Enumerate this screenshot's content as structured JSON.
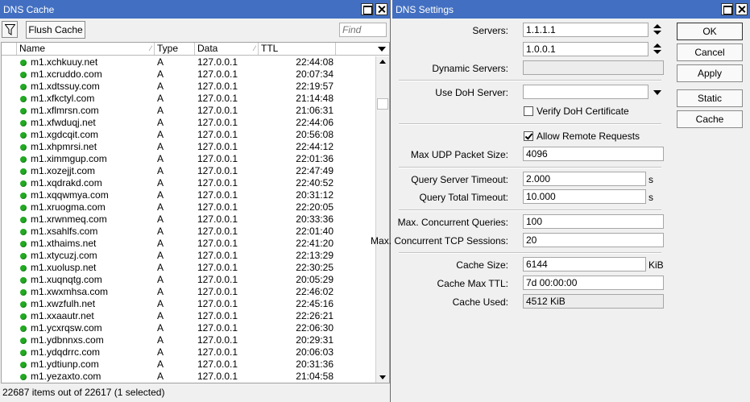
{
  "cache_window": {
    "title": "DNS Cache",
    "flush_label": "Flush Cache",
    "find_placeholder": "Find",
    "columns": {
      "name": "Name",
      "type": "Type",
      "data": "Data",
      "ttl": "TTL"
    },
    "rows": [
      {
        "name": "m1.xchkuuy.net",
        "type": "A",
        "data": "127.0.0.1",
        "ttl": "22:44:08"
      },
      {
        "name": "m1.xcruddo.com",
        "type": "A",
        "data": "127.0.0.1",
        "ttl": "20:07:34"
      },
      {
        "name": "m1.xdtssuy.com",
        "type": "A",
        "data": "127.0.0.1",
        "ttl": "22:19:57"
      },
      {
        "name": "m1.xfkctyl.com",
        "type": "A",
        "data": "127.0.0.1",
        "ttl": "21:14:48"
      },
      {
        "name": "m1.xflmrsn.com",
        "type": "A",
        "data": "127.0.0.1",
        "ttl": "21:06:31"
      },
      {
        "name": "m1.xfwduqj.net",
        "type": "A",
        "data": "127.0.0.1",
        "ttl": "22:44:06"
      },
      {
        "name": "m1.xgdcqit.com",
        "type": "A",
        "data": "127.0.0.1",
        "ttl": "20:56:08"
      },
      {
        "name": "m1.xhpmrsi.net",
        "type": "A",
        "data": "127.0.0.1",
        "ttl": "22:44:12"
      },
      {
        "name": "m1.ximmgup.com",
        "type": "A",
        "data": "127.0.0.1",
        "ttl": "22:01:36"
      },
      {
        "name": "m1.xozejjt.com",
        "type": "A",
        "data": "127.0.0.1",
        "ttl": "22:47:49"
      },
      {
        "name": "m1.xqdrakd.com",
        "type": "A",
        "data": "127.0.0.1",
        "ttl": "22:40:52"
      },
      {
        "name": "m1.xqqwmya.com",
        "type": "A",
        "data": "127.0.0.1",
        "ttl": "20:31:12"
      },
      {
        "name": "m1.xruogma.com",
        "type": "A",
        "data": "127.0.0.1",
        "ttl": "22:20:05"
      },
      {
        "name": "m1.xrwnmeq.com",
        "type": "A",
        "data": "127.0.0.1",
        "ttl": "20:33:36"
      },
      {
        "name": "m1.xsahlfs.com",
        "type": "A",
        "data": "127.0.0.1",
        "ttl": "22:01:40"
      },
      {
        "name": "m1.xthaims.net",
        "type": "A",
        "data": "127.0.0.1",
        "ttl": "22:41:20"
      },
      {
        "name": "m1.xtycuzj.com",
        "type": "A",
        "data": "127.0.0.1",
        "ttl": "22:13:29"
      },
      {
        "name": "m1.xuolusp.net",
        "type": "A",
        "data": "127.0.0.1",
        "ttl": "22:30:25"
      },
      {
        "name": "m1.xuqnqtg.com",
        "type": "A",
        "data": "127.0.0.1",
        "ttl": "20:05:29"
      },
      {
        "name": "m1.xwxmhsa.com",
        "type": "A",
        "data": "127.0.0.1",
        "ttl": "22:46:02"
      },
      {
        "name": "m1.xwzfulh.net",
        "type": "A",
        "data": "127.0.0.1",
        "ttl": "22:45:16"
      },
      {
        "name": "m1.xxaautr.net",
        "type": "A",
        "data": "127.0.0.1",
        "ttl": "22:26:21"
      },
      {
        "name": "m1.ycxrqsw.com",
        "type": "A",
        "data": "127.0.0.1",
        "ttl": "22:06:30"
      },
      {
        "name": "m1.ydbnnxs.com",
        "type": "A",
        "data": "127.0.0.1",
        "ttl": "20:29:31"
      },
      {
        "name": "m1.ydqdrrc.com",
        "type": "A",
        "data": "127.0.0.1",
        "ttl": "20:06:03"
      },
      {
        "name": "m1.ydtiunp.com",
        "type": "A",
        "data": "127.0.0.1",
        "ttl": "20:31:36"
      },
      {
        "name": "m1.yezaxto.com",
        "type": "A",
        "data": "127.0.0.1",
        "ttl": "21:04:58"
      }
    ],
    "status": "22687 items out of 22617 (1 selected)"
  },
  "settings_window": {
    "title": "DNS Settings",
    "labels": {
      "servers": "Servers:",
      "dynamic_servers": "Dynamic Servers:",
      "use_doh": "Use DoH Server:",
      "verify_doh": "Verify DoH Certificate",
      "allow_remote": "Allow Remote Requests",
      "max_udp": "Max UDP Packet Size:",
      "query_server_timeout": "Query Server Timeout:",
      "query_total_timeout": "Query Total Timeout:",
      "max_conc_queries": "Max. Concurrent Queries:",
      "max_conc_tcp": "Max. Concurrent TCP Sessions:",
      "cache_size": "Cache Size:",
      "cache_max_ttl": "Cache Max TTL:",
      "cache_used": "Cache Used:"
    },
    "values": {
      "server1": "1.1.1.1",
      "server2": "1.0.0.1",
      "dynamic_servers": "",
      "use_doh": "",
      "max_udp": "4096",
      "query_server_timeout": "2.000",
      "query_total_timeout": "10.000",
      "max_conc_queries": "100",
      "max_conc_tcp": "20",
      "cache_size": "6144",
      "cache_max_ttl": "7d 00:00:00",
      "cache_used": "4512 KiB"
    },
    "units": {
      "seconds": "s",
      "kib": "KiB"
    },
    "checkboxes": {
      "verify_doh": false,
      "allow_remote": true
    },
    "buttons": {
      "ok": "OK",
      "cancel": "Cancel",
      "apply": "Apply",
      "static": "Static",
      "cache": "Cache"
    }
  },
  "colors": {
    "titlebar": "#426fc1",
    "status_dot": "#22aa22"
  }
}
